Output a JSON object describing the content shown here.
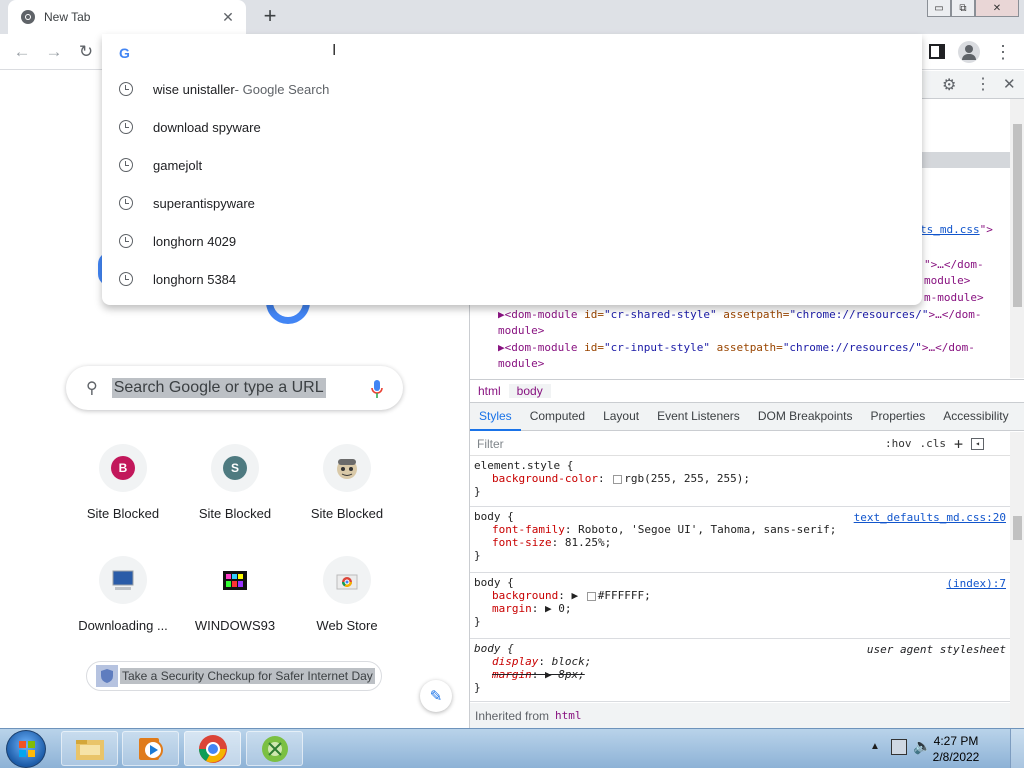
{
  "tab": {
    "title": "New Tab",
    "close": "✕"
  },
  "window": {
    "minimize": "▭",
    "restore": "⧉",
    "close": "✕"
  },
  "omnibox": {
    "value": "",
    "google_g": "G"
  },
  "suggestions": [
    {
      "text": "wise unistaller",
      "sub": " - Google Search"
    },
    {
      "text": "download spyware",
      "sub": ""
    },
    {
      "text": "gamejolt",
      "sub": ""
    },
    {
      "text": "superantispyware",
      "sub": ""
    },
    {
      "text": "longhorn 4029",
      "sub": ""
    },
    {
      "text": "longhorn 5384",
      "sub": ""
    }
  ],
  "ntp": {
    "search_placeholder": "Search Google or type a URL",
    "shortcuts": [
      {
        "label": "Site Blocked",
        "letter": "B",
        "color": "#c2185b",
        "icon": "letter-icon"
      },
      {
        "label": "Site Blocked",
        "letter": "S",
        "color": "#4e7a80",
        "icon": "letter-icon"
      },
      {
        "label": "Site Blocked",
        "letter": "",
        "color": "",
        "icon": "face-icon"
      },
      {
        "label": "Downloading ...",
        "letter": "",
        "color": "",
        "icon": "monitor-icon"
      },
      {
        "label": "WINDOWS93",
        "letter": "",
        "color": "",
        "icon": "windows93-icon"
      },
      {
        "label": "Web Store",
        "letter": "",
        "color": "",
        "icon": "chrome-web-store-icon"
      }
    ],
    "promo": "Take a Security Checkup for Safer Internet Day"
  },
  "devtools": {
    "dom": [
      {
        "link": "ts_md.css",
        "tail": "\">"
      },
      {
        "tail": "\">…</dom-"
      },
      {
        "tail": "module>"
      },
      {
        "tail": "m-module>"
      },
      {
        "tag_open": "▶<",
        "tag": "dom-module",
        "attr": " id=",
        "id": "\"cr-shared-style\"",
        "attr2": " assetpath=",
        "path": "\"chrome://resources/\"",
        "tail": ">…</dom-"
      },
      {
        "tail": "module>"
      },
      {
        "tag_open": "▶<",
        "tag": "dom-module",
        "attr": " id=",
        "id": "\"cr-input-style\"",
        "attr2": " assetpath=",
        "path": "\"chrome://resources/\"",
        "tail": ">…</dom-"
      },
      {
        "tail": "module>"
      }
    ],
    "breadcrumbs": [
      "html",
      "body"
    ],
    "tabs": [
      "Styles",
      "Computed",
      "Layout",
      "Event Listeners",
      "DOM Breakpoints",
      "Properties",
      "Accessibility"
    ],
    "filter_placeholder": "Filter",
    "hov": ":hov",
    "cls": ".cls",
    "plus": "+",
    "rules": [
      {
        "selector": "element.style {",
        "source": "",
        "decls": [
          {
            "name": "background-color",
            "value": "rgb(255, 255, 255);",
            "swatch": true
          }
        ]
      },
      {
        "selector": "body {",
        "source": "text_defaults_md.css:20",
        "decls": [
          {
            "name": "font-family",
            "value": "Roboto, 'Segoe UI', Tahoma, sans-serif;"
          },
          {
            "name": "font-size",
            "value": "81.25%;"
          }
        ]
      },
      {
        "selector": "body {",
        "source": "(index):7",
        "decls": [
          {
            "name": "background",
            "value": "▶ ",
            "swatch": true,
            "value2": "#FFFFFF;"
          },
          {
            "name": "margin",
            "value": "▶ 0;"
          }
        ]
      },
      {
        "selector": "body {",
        "source": "user agent stylesheet",
        "decls": [
          {
            "name": "display",
            "value": "block;"
          },
          {
            "name": "margin",
            "value": "▶ 8px;",
            "struck": true
          }
        ]
      }
    ],
    "inherited_label": "Inherited from",
    "inherited_tag": "html"
  },
  "taskbar": {
    "time": "4:27 PM",
    "date": "2/8/2022"
  }
}
